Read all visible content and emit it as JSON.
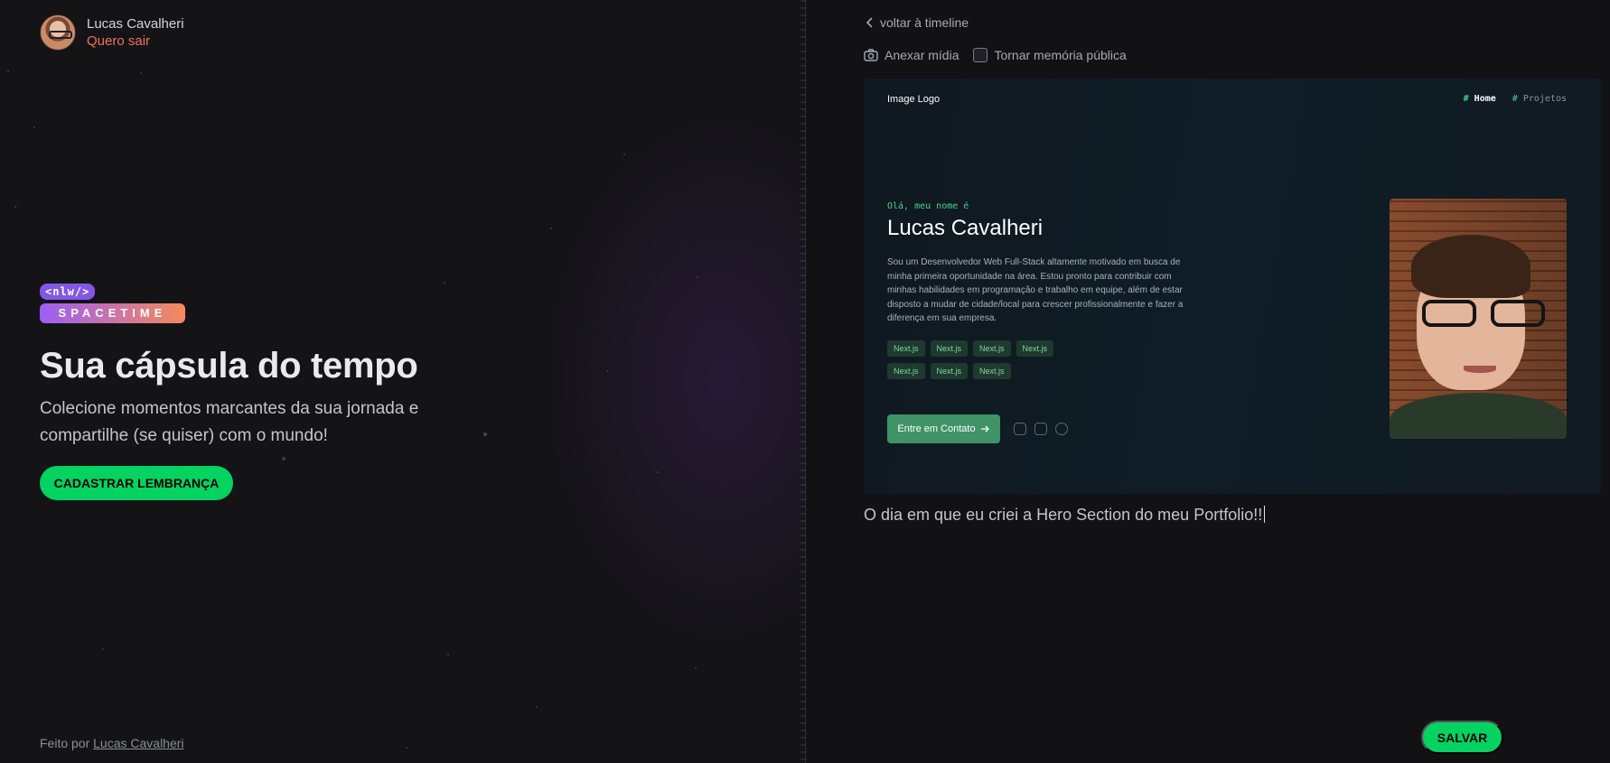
{
  "user": {
    "name": "Lucas Cavalheri",
    "logout_label": "Quero sair"
  },
  "brand": {
    "badge": "<nlw/>",
    "wordmark": "SPACETIME"
  },
  "hero": {
    "title": "Sua cápsula do tempo",
    "subtitle": "Colecione momentos marcantes da sua jornada e compartilhe (se quiser) com o mundo!",
    "cta_label": "CADASTRAR LEMBRANÇA"
  },
  "footer": {
    "prefix": "Feito por",
    "author": "Lucas Cavalheri"
  },
  "form": {
    "back_label": "voltar à timeline",
    "attach_label": "Anexar mídia",
    "public_label": "Tornar memória pública",
    "public_checked": false,
    "content": "O dia em que eu criei a Hero Section do meu Portfolio!!",
    "save_label": "SALVAR"
  },
  "preview": {
    "logo": "Image Logo",
    "nav": [
      {
        "hash": "#",
        "label": "Home",
        "active": true
      },
      {
        "hash": "#",
        "label": "Projetos",
        "active": false
      }
    ],
    "greeting": "Olá, meu nome é",
    "name": "Lucas Cavalheri",
    "description": "Sou um Desenvolvedor Web Full-Stack altamente motivado em busca de minha primeira oportunidade na área. Estou pronto para contribuir com minhas habilidades em programação e trabalho em equipe, além de estar disposto a mudar de cidade/local para crescer profissionalmente e fazer a diferença em sua empresa.",
    "tags": [
      "Next.js",
      "Next.js",
      "Next.js",
      "Next.js",
      "Next.js",
      "Next.js",
      "Next.js"
    ],
    "contact_label": "Entre em Contato"
  },
  "colors": {
    "accent_green": "#04d361",
    "logout_red": "#f56f59",
    "brand_purple": "#8257e5"
  },
  "icons": [
    "chevron-left-icon",
    "camera-icon",
    "arrow-right-icon",
    "github-icon",
    "linkedin-icon",
    "whatsapp-icon"
  ]
}
